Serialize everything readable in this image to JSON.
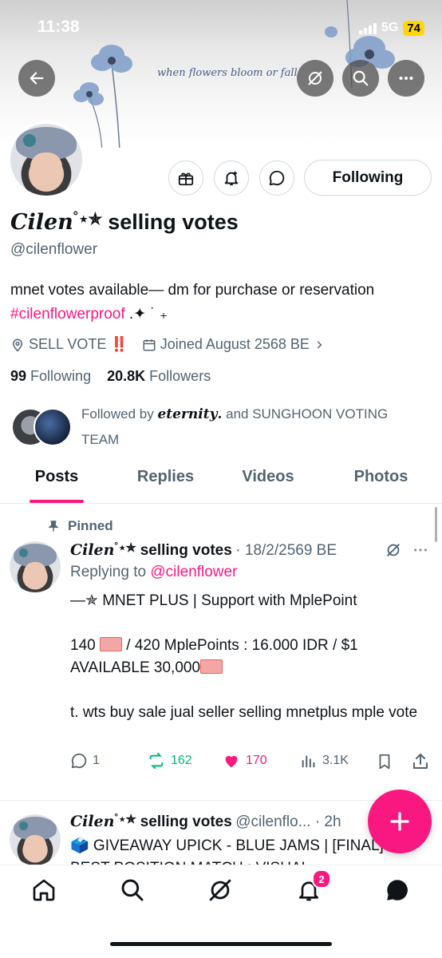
{
  "status_bar": {
    "time": "11:38",
    "network": "5G",
    "battery": "74"
  },
  "banner": {
    "text": "when flowers bloom or fall"
  },
  "profile": {
    "display_name_script": "Cilen",
    "display_name_symbols": "˚⋆✯",
    "display_name_suffix": "selling votes",
    "handle": "@cilenflower",
    "bio_line1": "mnet votes available— dm for purchase or reservation",
    "bio_hashtag": "#cilenflowerproof",
    "bio_sparkle": ".✦ ˙ ₊",
    "location": "SELL VOTE",
    "location_emoji": "‼️",
    "joined": "Joined August 2568 BE",
    "following_count": "99",
    "following_label": "Following",
    "followers_count": "20.8K",
    "followers_label": "Followers",
    "followed_by_prefix": "Followed by",
    "followed_by_name": "𝒆𝒕𝒆𝒓𝒏𝒊𝒕𝒚.",
    "followed_by_rest": "and SUNGHOON VOTING TEAM",
    "follow_button": "Following"
  },
  "tabs": [
    {
      "label": "Posts",
      "active": true
    },
    {
      "label": "Replies",
      "active": false
    },
    {
      "label": "Videos",
      "active": false
    },
    {
      "label": "Photos",
      "active": false
    }
  ],
  "posts": [
    {
      "pinned_label": "Pinned",
      "author_script": "Cilen",
      "author_symbols": "˚⋆✯",
      "author_suffix": "selling votes",
      "meta": "· 18/2/2569 BE",
      "replying_prefix": "Replying to",
      "replying_handle": "@cilenflower",
      "line1": "—✯ MNET PLUS | Support with MplePoint",
      "line2a": "140",
      "line2b": "/ 420 MplePoints : 16.000 IDR / $1",
      "line3": "AVAILABLE 30,000",
      "line4": "t. wts buy sale jual seller selling mnetplus mple vote",
      "replies": "1",
      "reposts": "162",
      "likes": "170",
      "views": "3.1K"
    },
    {
      "author_script": "Cilen",
      "author_symbols": "˚⋆✯",
      "author_suffix": "selling votes",
      "meta": "@cilenflo... · 2h",
      "line1": "🗳️ GIVEAWAY UPICK - BLUE JAMS | [FINAL]",
      "line2": "BEST POSITION MATCH : VISUAL"
    }
  ],
  "bottom_nav": {
    "notifications_badge": "2"
  },
  "colors": {
    "accent": "#f91880",
    "repost": "#00ba7c",
    "text": "#0f1419",
    "muted": "#536471"
  }
}
